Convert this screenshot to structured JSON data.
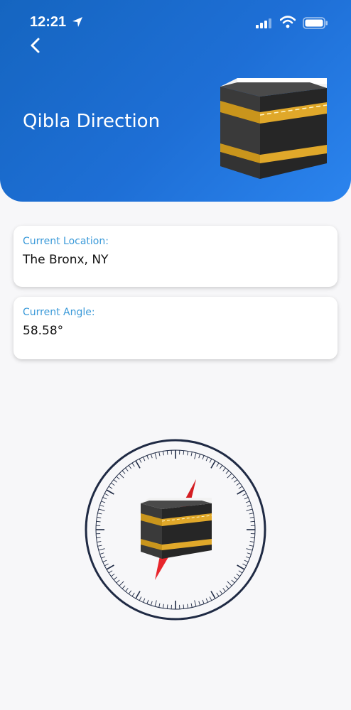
{
  "status_bar": {
    "time": "12:21",
    "icons": [
      "location-arrow-icon",
      "signal-icon",
      "wifi-icon",
      "battery-icon"
    ]
  },
  "header": {
    "title": "Qibla Direction",
    "back_icon": "chevron-left-icon",
    "image": "kaaba-icon"
  },
  "location_card": {
    "label": "Current Location:",
    "value": "The Bronx, NY"
  },
  "angle_card": {
    "label": "Current Angle:",
    "value": "58.58°"
  },
  "compass": {
    "needle_color": "#e8262c",
    "ring_color": "#1f2a44",
    "center_image": "kaaba-icon"
  },
  "colors": {
    "header_gradient_start": "#1565c0",
    "header_gradient_end": "#2b84ee",
    "label_color": "#3b9ad9",
    "background": "#f7f7f9"
  }
}
